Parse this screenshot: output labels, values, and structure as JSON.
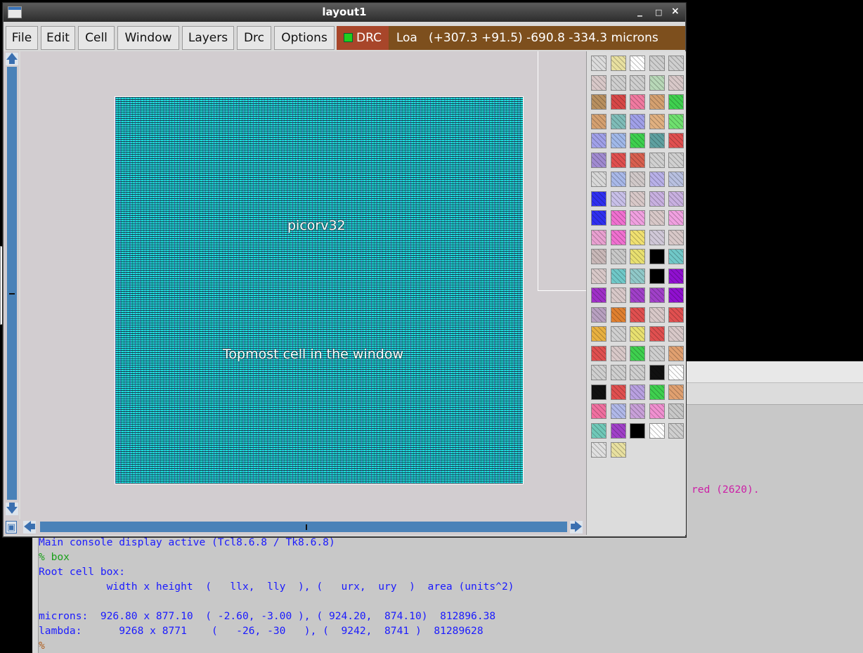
{
  "window": {
    "title": "layout1",
    "controls": [
      "_",
      "□",
      "×"
    ]
  },
  "menu": {
    "items": [
      "File",
      "Edit",
      "Cell",
      "Window",
      "Layers",
      "Drc",
      "Options"
    ],
    "drc_label": "DRC",
    "status_text": "Loa   (+307.3 +91.5) -690.8 -334.3 microns"
  },
  "layout": {
    "cell_name": "picorv32",
    "cell_caption": "Topmost cell in the window"
  },
  "palette": {
    "swatches": [
      [
        "#dcdcdc",
        "#e8e0a0",
        "#ffffff",
        "#cfcfcf",
        "#cfcfcf"
      ],
      [
        "#d8c8c8",
        "#cfcfcf",
        "#cfcfcf",
        "#b8d8b8",
        "#d8c8c8"
      ],
      [
        "#b89060",
        "#d84848",
        "#f07aa0",
        "#d4a070",
        "#3fd04f"
      ],
      [
        "#d4a070",
        "#7fbcb8",
        "#a0a0e8",
        "#e0b080",
        "#6fe06f"
      ],
      [
        "#a0a0e8",
        "#a0b8e8",
        "#3fd04f",
        "#5fa0a0",
        "#e05050"
      ],
      [
        "#a08ad0",
        "#e05050",
        "#d86050",
        "#d0d0d0",
        "#d0d0d0"
      ],
      [
        "#d8d8d8",
        "#a8b8e8",
        "#d0c8c8",
        "#b8b0e8",
        "#b8c0e0"
      ],
      [
        "#3030f0",
        "#c8c0e8",
        "#d8c8c8",
        "#c8b0e0",
        "#c8b0e0"
      ],
      [
        "#3030f0",
        "#f070d0",
        "#f0a0e0",
        "#d8c8c8",
        "#f0a0e0"
      ],
      [
        "#e8a0d0",
        "#f070d0",
        "#f0e070",
        "#d0c8d8",
        "#d8c8c8"
      ],
      [
        "#c8b8b8",
        "#c8c8c8",
        "#e8e070",
        "#000000",
        "#70c8c8"
      ],
      [
        "#d8c8c8",
        "#70c8c8",
        "#90c8c8",
        "#000000",
        "#9010d0"
      ],
      [
        "#a030c8",
        "#d8c8c8",
        "#a040c8",
        "#a040c8",
        "#9010d0"
      ],
      [
        "#b8a0c0",
        "#e08030",
        "#e05050",
        "#d8c8c8",
        "#e05050"
      ],
      [
        "#e8b040",
        "#d0d0d0",
        "#e8e070",
        "#e05050",
        "#d8c8c8"
      ],
      [
        "#e05050",
        "#d8c8c8",
        "#3fd04f",
        "#cfcfcf",
        "#e0a070"
      ],
      [
        "#cfcfcf",
        "#cfcfcf",
        "#cfcfcf",
        "#111111",
        "#ffffff"
      ],
      [
        "#111111",
        "#e05050",
        "#b8a0e0",
        "#3fd04f",
        "#e0a070"
      ],
      [
        "#f070a0",
        "#b0b8e8",
        "#c8a0d8",
        "#f090d0",
        "#c8c8c8"
      ],
      [
        "#70c8b8",
        "#a040c8",
        "#000000",
        "#ffffff",
        "#cfcfcf"
      ],
      [
        "#e0e0e0",
        "#e8e0a0"
      ]
    ]
  },
  "console": {
    "lines": [
      {
        "text": "Main console display active (Tcl8.6.8 / Tk8.6.8)",
        "style": "blue"
      },
      {
        "text": "% box",
        "style": "green"
      },
      {
        "text": "Root cell box:",
        "style": "blue"
      },
      {
        "text": "           width x height  (   llx,  lly  ), (   urx,  ury  )  area (units^2)",
        "style": "blue"
      },
      {
        "text": "",
        "style": "blue"
      },
      {
        "text": "microns:  926.80 x 877.10  ( -2.60, -3.00 ), ( 924.20,  874.10)  812896.38",
        "style": "blue"
      },
      {
        "text": "lambda:      9268 x 8771    (   -26, -30   ), (  9242,  8741 )  81289628",
        "style": "blue"
      },
      {
        "text": "%",
        "style": "prompt"
      }
    ],
    "partial_text": "red (2620)."
  },
  "colors": {
    "menu_drc_bg": "#a8462a",
    "status_bg": "#7d4f1d",
    "chip_fill": "#1fdcdc",
    "scroll_track": "#4a82b8"
  }
}
